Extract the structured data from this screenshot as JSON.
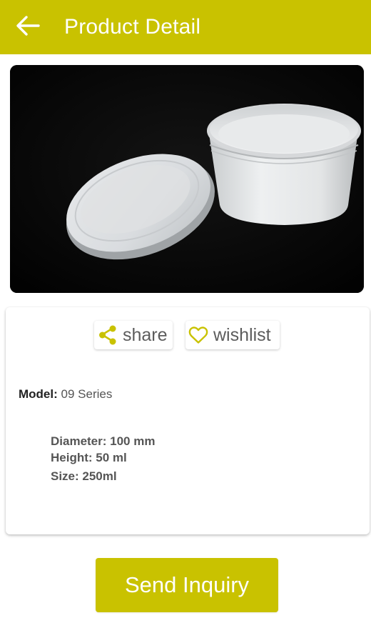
{
  "appbar": {
    "back_icon": "arrow-left-icon",
    "title": "Product Detail",
    "color": "#c9c200"
  },
  "product": {
    "image_alt": "White plastic round container with lid"
  },
  "actions": {
    "share_label": "share",
    "share_icon": "share-icon",
    "wishlist_label": "wishlist",
    "wishlist_icon": "heart-outline-icon",
    "icon_color": "#c9c200"
  },
  "details": {
    "model_key": "Model:",
    "model_value": "09 Series",
    "specs": [
      "Diameter: 100 mm",
      "Height: 50 ml",
      "Size: 250ml"
    ]
  },
  "footer": {
    "inquiry_label": "Send Inquiry"
  }
}
